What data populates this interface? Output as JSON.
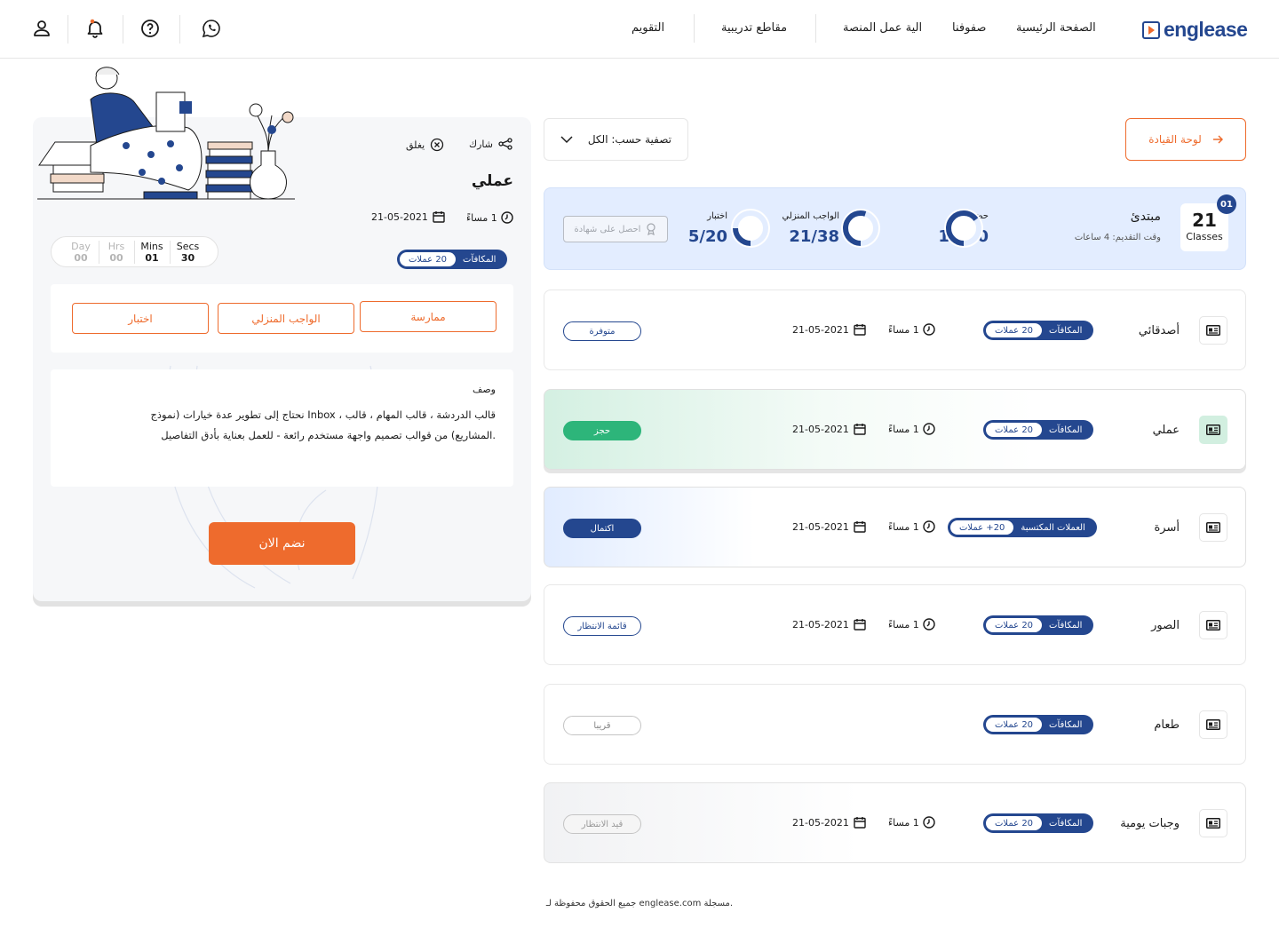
{
  "brand": {
    "logo_text": "englease"
  },
  "nav": {
    "home": "الصفحة الرئيسية",
    "classes": "صفوفنا",
    "how": "الية عمل المنصة",
    "clips": "مقاطع تدريبية",
    "calendar": "التقويم"
  },
  "header_icons": [
    "whatsapp-icon",
    "help-icon",
    "bell-icon",
    "user-icon"
  ],
  "toolbar": {
    "leaderboard": "لوحة القيادة",
    "filter": "تصفية حسب: الكل"
  },
  "summary": {
    "badge": "01",
    "count": "21",
    "count_label": "Classes",
    "level": "مبتدئ",
    "progress_time": "وقت التقديم: 4 ساعات",
    "attended_label": "حضرها",
    "attended_value": "13/20",
    "attended_fraction": 0.65,
    "homework_label": "الواجب المنزلي",
    "homework_value": "21/38",
    "homework_fraction": 0.55,
    "test_label": "اختبار",
    "test_value": "5/20",
    "test_fraction": 0.25,
    "certificate": "احصل على شهادة"
  },
  "classes": [
    {
      "title": "أصدقائي",
      "reward_label": "المكافآت",
      "reward_value": "20 عملات",
      "time": "1 مساءً",
      "date": "21-05-2021",
      "status": "متوفرة"
    },
    {
      "title": "عملي",
      "reward_label": "المكافآت",
      "reward_value": "20 عملات",
      "time": "1 مساءً",
      "date": "21-05-2021",
      "status": "حجز"
    },
    {
      "title": "أسرة",
      "reward_label": "العملات المكتسبة",
      "reward_value": "20+ عملات",
      "time": "1 مساءً",
      "date": "21-05-2021",
      "status": "اكتمال"
    },
    {
      "title": "الصور",
      "reward_label": "المكافآت",
      "reward_value": "20 عملات",
      "time": "1 مساءً",
      "date": "21-05-2021",
      "status": "قائمة الانتظار"
    },
    {
      "title": "طعام",
      "reward_label": "المكافآت",
      "reward_value": "20 عملات",
      "time": "",
      "date": "",
      "status": "قريبا"
    },
    {
      "title": "وجبات يومية",
      "reward_label": "المكافآت",
      "reward_value": "20 عملات",
      "time": "1 مساءً",
      "date": "21-05-2021",
      "status": "قيد الانتظار"
    }
  ],
  "detail": {
    "share": "شارك",
    "close": "يغلق",
    "title": "عملي",
    "time": "1 مساءً",
    "date": "21-05-2021",
    "reward_label": "المكافآت",
    "reward_value": "20 عملات",
    "countdown": [
      {
        "label": "Day",
        "value": "00"
      },
      {
        "label": "Hrs",
        "value": "00"
      },
      {
        "label": "Mins",
        "value": "01"
      },
      {
        "label": "Secs",
        "value": "30"
      }
    ],
    "tabs": [
      "ممارسة",
      "الواجب المنزلي",
      "اختبار"
    ],
    "desc_title": "وصف",
    "desc_line1": "نحتاج إلى تطوير عدة خيارات (نموذج Inbox ، قالب الدردشة ، قالب المهام ، قالب",
    "desc_line2": "المشاريع) من قوالب تصميم واجهة مستخدم رائعة - للعمل بعناية بأدق التفاصيل.",
    "join": "نضم الان"
  },
  "footer": "جميع الحقوق محفوظة لـ englease.com مسجلة.",
  "colors": {
    "accent": "#ee6b2d",
    "navy": "#24478f",
    "green": "#2db57a",
    "summary_bg": "#e3edff"
  }
}
